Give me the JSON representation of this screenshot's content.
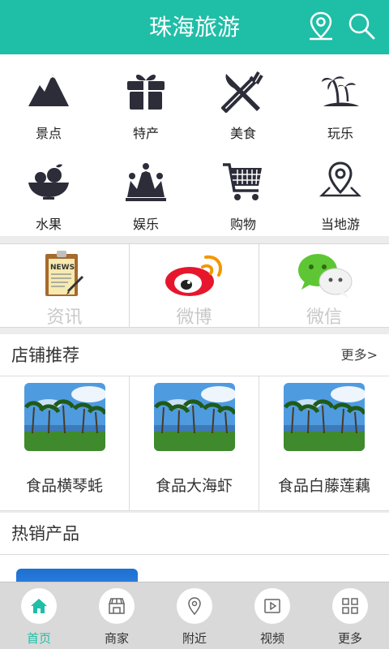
{
  "header": {
    "title": "珠海旅游",
    "location_icon": "location-pin-icon",
    "search_icon": "search-icon",
    "bg_color": "#1fbea7"
  },
  "categories": [
    {
      "label": "景点",
      "icon": "mountain-icon"
    },
    {
      "label": "特产",
      "icon": "gift-icon"
    },
    {
      "label": "美食",
      "icon": "fork-knife-icon"
    },
    {
      "label": "玩乐",
      "icon": "palm-island-icon"
    },
    {
      "label": "水果",
      "icon": "fruit-bowl-icon"
    },
    {
      "label": "娱乐",
      "icon": "crown-icon"
    },
    {
      "label": "购物",
      "icon": "shopping-cart-icon"
    },
    {
      "label": "当地游",
      "icon": "map-pin-icon"
    }
  ],
  "social": [
    {
      "label": "资讯",
      "icon": "news-clipboard-icon"
    },
    {
      "label": "微博",
      "icon": "weibo-icon"
    },
    {
      "label": "微信",
      "icon": "wechat-icon"
    }
  ],
  "shop_section": {
    "title": "店铺推荐",
    "more": "更多>",
    "items": [
      {
        "label": "食品横琴蚝"
      },
      {
        "label": "食品大海虾"
      },
      {
        "label": "食品白藤莲藕"
      }
    ]
  },
  "hot_section": {
    "title": "热销产品"
  },
  "tabs": [
    {
      "label": "首页",
      "icon": "home-icon",
      "active": true
    },
    {
      "label": "商家",
      "icon": "storefront-icon",
      "active": false
    },
    {
      "label": "附近",
      "icon": "nearby-pin-icon",
      "active": false
    },
    {
      "label": "视频",
      "icon": "video-play-icon",
      "active": false
    },
    {
      "label": "更多",
      "icon": "grid-more-icon",
      "active": false
    }
  ],
  "colors": {
    "accent": "#1fbea7",
    "icon_dark": "#2d2d3a",
    "muted_text": "#c8c8c8"
  }
}
